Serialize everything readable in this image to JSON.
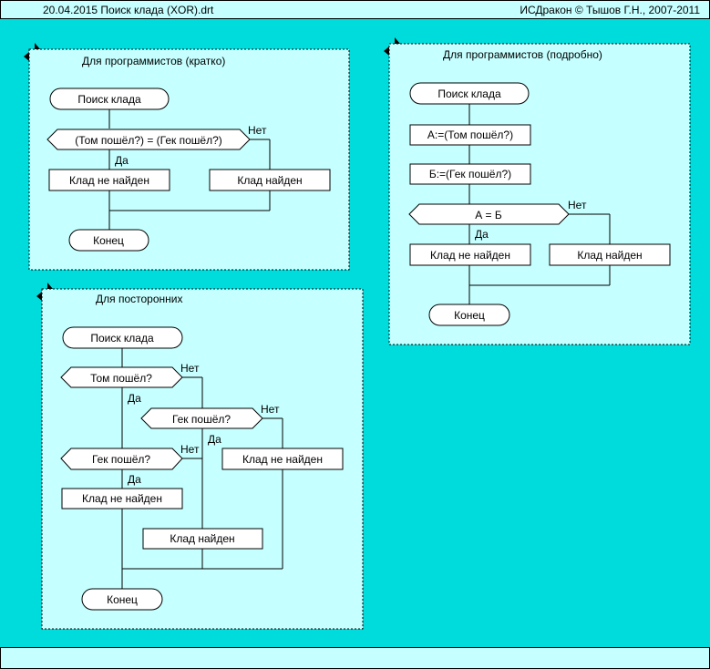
{
  "header": {
    "left_text": "20.04.2015  Поиск клада (XOR).drt",
    "right_text": "ИСДракон © Тышов Г.Н., 2007-2011"
  },
  "colors": {
    "canvas": "#00dcdc",
    "panel": "#c6ffff",
    "box": "#ffffff",
    "line": "#000000"
  },
  "panels": {
    "brief": {
      "title": "Для программистов (кратко)",
      "start": "Поиск клада",
      "question": "(Том пошёл?) = (Гек пошёл?)",
      "yes": "Да",
      "no": "Нет",
      "left_action": "Клад не найден",
      "right_action": "Клад найден",
      "end": "Конец"
    },
    "detailed": {
      "title": "Для программистов (подробно)",
      "start": "Поиск клада",
      "action1": "А:=(Том пошёл?)",
      "action2": "Б:=(Гек пошёл?)",
      "question": "А = Б",
      "yes": "Да",
      "no": "Нет",
      "left_action": "Клад не найден",
      "right_action": "Клад найден",
      "end": "Конец"
    },
    "outsiders": {
      "title": "Для посторонних",
      "start": "Поиск клада",
      "q1": "Том пошёл?",
      "q2": "Гек пошёл?",
      "q3": "Гек пошёл?",
      "yes": "Да",
      "no": "Нет",
      "a_left": "Клад не найден",
      "a_mid": "Клад найден",
      "a_right": "Клад не найден",
      "end": "Конец"
    }
  }
}
